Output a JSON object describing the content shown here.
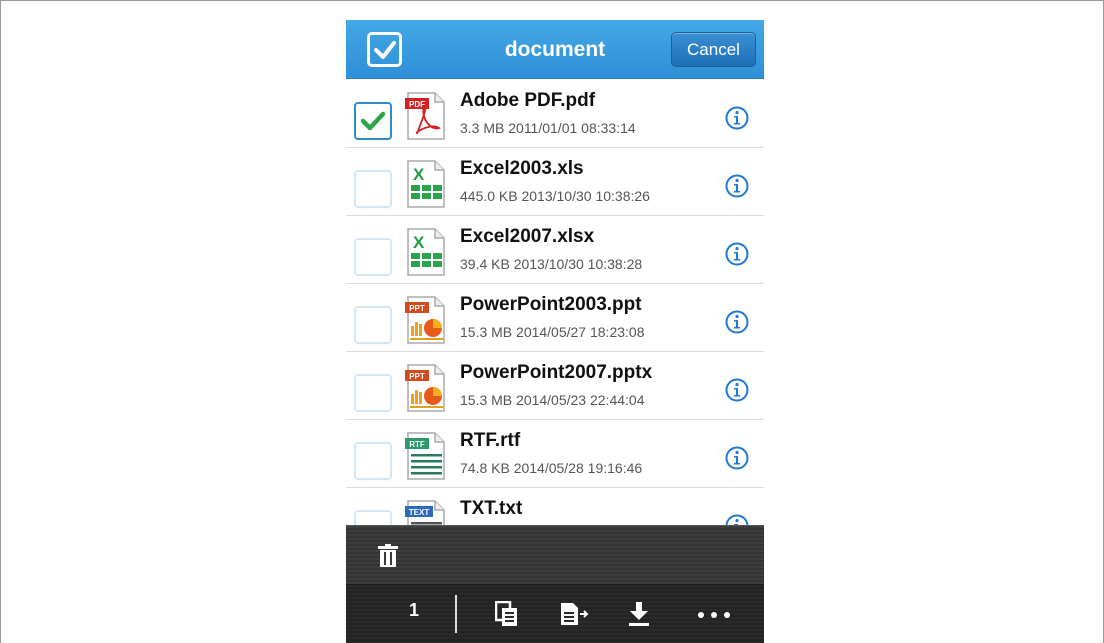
{
  "header": {
    "title": "document",
    "cancel_label": "Cancel",
    "select_all_checked": true
  },
  "files": [
    {
      "name": "Adobe PDF.pdf",
      "meta": "3.3 MB 2011/01/01 08:33:14",
      "type": "pdf",
      "badge": "PDF",
      "checked": true
    },
    {
      "name": "Excel2003.xls",
      "meta": "445.0 KB 2013/10/30 10:38:26",
      "type": "excel",
      "badge": "X",
      "checked": false
    },
    {
      "name": "Excel2007.xlsx",
      "meta": "39.4 KB 2013/10/30 10:38:28",
      "type": "excel",
      "badge": "X",
      "checked": false
    },
    {
      "name": "PowerPoint2003.ppt",
      "meta": "15.3 MB 2014/05/27 18:23:08",
      "type": "ppt",
      "badge": "PPT",
      "checked": false
    },
    {
      "name": "PowerPoint2007.pptx",
      "meta": "15.3 MB 2014/05/23 22:44:04",
      "type": "ppt",
      "badge": "PPT",
      "checked": false
    },
    {
      "name": "RTF.rtf",
      "meta": "74.8 KB 2014/05/28 19:16:46",
      "type": "rtf",
      "badge": "RTF",
      "checked": false
    },
    {
      "name": "TXT.txt",
      "meta": "",
      "type": "txt",
      "badge": "TEXT",
      "checked": false
    }
  ],
  "toolbar": {
    "selected_count": "1",
    "icons": [
      "trash-icon",
      "copy-icon",
      "move-icon",
      "download-icon",
      "more-icon"
    ]
  },
  "colors": {
    "header_blue": "#3a9ee0",
    "check_green": "#2aa44a",
    "info_blue": "#1f78d1"
  }
}
